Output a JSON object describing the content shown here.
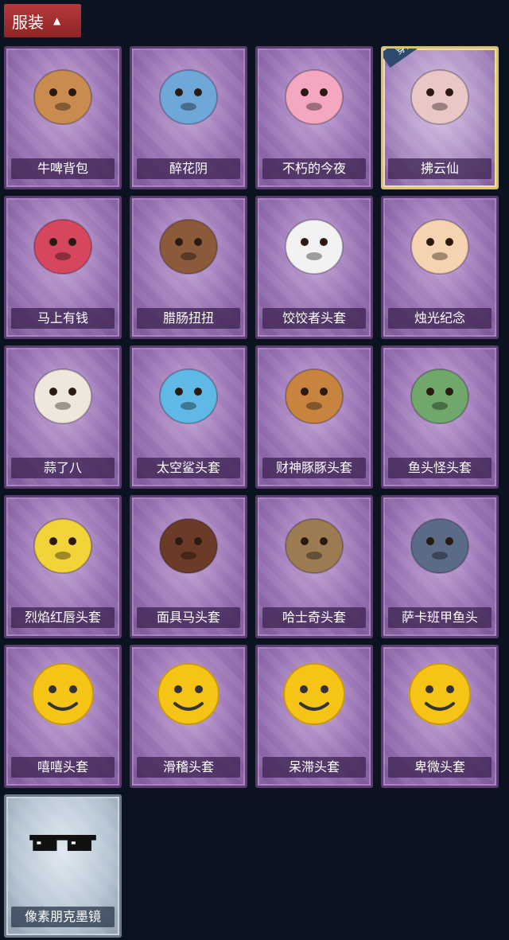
{
  "section": {
    "title": "服装"
  },
  "items": [
    {
      "name": "牛啤背包",
      "icon": "cow-beer-backpack-icon",
      "color": "#c98b4e"
    },
    {
      "name": "醉花阴",
      "icon": "flower-charm-icon",
      "color": "#6fa8d8"
    },
    {
      "name": "不朽的今夜",
      "icon": "pink-cat-bowl-icon",
      "color": "#f3a7c0"
    },
    {
      "name": "拂云仙",
      "icon": "cloud-fairy-pendant-icon",
      "color": "#e9c7c7",
      "badge": "穿戴"
    },
    {
      "name": "马上有钱",
      "icon": "red-horse-head-icon",
      "color": "#d6465e"
    },
    {
      "name": "腊肠扭扭",
      "icon": "dachshund-head-icon",
      "color": "#8b5a3a"
    },
    {
      "name": "饺饺者头套",
      "icon": "dumpling-head-icon",
      "color": "#f2f2f2"
    },
    {
      "name": "烛光纪念",
      "icon": "candle-head-icon",
      "color": "#f5d2b0"
    },
    {
      "name": "蒜了八",
      "icon": "garlic-head-icon",
      "color": "#efe7dc"
    },
    {
      "name": "太空鲨头套",
      "icon": "space-shark-head-icon",
      "color": "#5fb8e6"
    },
    {
      "name": "财神豚豚头套",
      "icon": "capybara-god-head-icon",
      "color": "#c8843f"
    },
    {
      "name": "鱼头怪头套",
      "icon": "fish-monster-head-icon",
      "color": "#6fa86a"
    },
    {
      "name": "烈焰红唇头套",
      "icon": "pikachu-mask-icon",
      "color": "#f3d33a"
    },
    {
      "name": "面具马头套",
      "icon": "horse-mask-icon",
      "color": "#6b3b27"
    },
    {
      "name": "哈士奇头套",
      "icon": "husky-sunglasses-icon",
      "color": "#9c7a52"
    },
    {
      "name": "萨卡班甲鱼头",
      "icon": "fish-head-icon",
      "color": "#5b6a86"
    },
    {
      "name": "嘻嘻头套",
      "icon": "grin-emoji-icon",
      "color": "#f6c417"
    },
    {
      "name": "滑稽头套",
      "icon": "funny-emoji-icon",
      "color": "#f6c417"
    },
    {
      "name": "呆滞头套",
      "icon": "blank-stare-emoji-icon",
      "color": "#f6c417"
    },
    {
      "name": "卑微头套",
      "icon": "meek-emoji-icon",
      "color": "#f6c417"
    },
    {
      "name": "像素朋克墨镜",
      "icon": "pixel-sunglasses-icon",
      "color": "#111111"
    }
  ]
}
